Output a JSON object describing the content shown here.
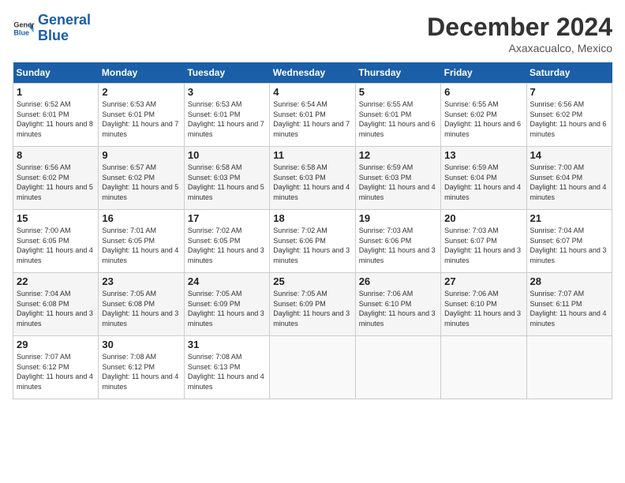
{
  "header": {
    "logo_line1": "General",
    "logo_line2": "Blue",
    "month": "December 2024",
    "location": "Axaxacualco, Mexico"
  },
  "weekdays": [
    "Sunday",
    "Monday",
    "Tuesday",
    "Wednesday",
    "Thursday",
    "Friday",
    "Saturday"
  ],
  "weeks": [
    [
      {
        "day": "1",
        "sunrise": "6:52 AM",
        "sunset": "6:01 PM",
        "daylight": "11 hours and 8 minutes."
      },
      {
        "day": "2",
        "sunrise": "6:53 AM",
        "sunset": "6:01 PM",
        "daylight": "11 hours and 7 minutes."
      },
      {
        "day": "3",
        "sunrise": "6:53 AM",
        "sunset": "6:01 PM",
        "daylight": "11 hours and 7 minutes."
      },
      {
        "day": "4",
        "sunrise": "6:54 AM",
        "sunset": "6:01 PM",
        "daylight": "11 hours and 7 minutes."
      },
      {
        "day": "5",
        "sunrise": "6:55 AM",
        "sunset": "6:01 PM",
        "daylight": "11 hours and 6 minutes."
      },
      {
        "day": "6",
        "sunrise": "6:55 AM",
        "sunset": "6:02 PM",
        "daylight": "11 hours and 6 minutes."
      },
      {
        "day": "7",
        "sunrise": "6:56 AM",
        "sunset": "6:02 PM",
        "daylight": "11 hours and 6 minutes."
      }
    ],
    [
      {
        "day": "8",
        "sunrise": "6:56 AM",
        "sunset": "6:02 PM",
        "daylight": "11 hours and 5 minutes."
      },
      {
        "day": "9",
        "sunrise": "6:57 AM",
        "sunset": "6:02 PM",
        "daylight": "11 hours and 5 minutes."
      },
      {
        "day": "10",
        "sunrise": "6:58 AM",
        "sunset": "6:03 PM",
        "daylight": "11 hours and 5 minutes."
      },
      {
        "day": "11",
        "sunrise": "6:58 AM",
        "sunset": "6:03 PM",
        "daylight": "11 hours and 4 minutes."
      },
      {
        "day": "12",
        "sunrise": "6:59 AM",
        "sunset": "6:03 PM",
        "daylight": "11 hours and 4 minutes."
      },
      {
        "day": "13",
        "sunrise": "6:59 AM",
        "sunset": "6:04 PM",
        "daylight": "11 hours and 4 minutes."
      },
      {
        "day": "14",
        "sunrise": "7:00 AM",
        "sunset": "6:04 PM",
        "daylight": "11 hours and 4 minutes."
      }
    ],
    [
      {
        "day": "15",
        "sunrise": "7:00 AM",
        "sunset": "6:05 PM",
        "daylight": "11 hours and 4 minutes."
      },
      {
        "day": "16",
        "sunrise": "7:01 AM",
        "sunset": "6:05 PM",
        "daylight": "11 hours and 4 minutes."
      },
      {
        "day": "17",
        "sunrise": "7:02 AM",
        "sunset": "6:05 PM",
        "daylight": "11 hours and 3 minutes."
      },
      {
        "day": "18",
        "sunrise": "7:02 AM",
        "sunset": "6:06 PM",
        "daylight": "11 hours and 3 minutes."
      },
      {
        "day": "19",
        "sunrise": "7:03 AM",
        "sunset": "6:06 PM",
        "daylight": "11 hours and 3 minutes."
      },
      {
        "day": "20",
        "sunrise": "7:03 AM",
        "sunset": "6:07 PM",
        "daylight": "11 hours and 3 minutes."
      },
      {
        "day": "21",
        "sunrise": "7:04 AM",
        "sunset": "6:07 PM",
        "daylight": "11 hours and 3 minutes."
      }
    ],
    [
      {
        "day": "22",
        "sunrise": "7:04 AM",
        "sunset": "6:08 PM",
        "daylight": "11 hours and 3 minutes."
      },
      {
        "day": "23",
        "sunrise": "7:05 AM",
        "sunset": "6:08 PM",
        "daylight": "11 hours and 3 minutes."
      },
      {
        "day": "24",
        "sunrise": "7:05 AM",
        "sunset": "6:09 PM",
        "daylight": "11 hours and 3 minutes."
      },
      {
        "day": "25",
        "sunrise": "7:05 AM",
        "sunset": "6:09 PM",
        "daylight": "11 hours and 3 minutes."
      },
      {
        "day": "26",
        "sunrise": "7:06 AM",
        "sunset": "6:10 PM",
        "daylight": "11 hours and 3 minutes."
      },
      {
        "day": "27",
        "sunrise": "7:06 AM",
        "sunset": "6:10 PM",
        "daylight": "11 hours and 3 minutes."
      },
      {
        "day": "28",
        "sunrise": "7:07 AM",
        "sunset": "6:11 PM",
        "daylight": "11 hours and 4 minutes."
      }
    ],
    [
      {
        "day": "29",
        "sunrise": "7:07 AM",
        "sunset": "6:12 PM",
        "daylight": "11 hours and 4 minutes."
      },
      {
        "day": "30",
        "sunrise": "7:08 AM",
        "sunset": "6:12 PM",
        "daylight": "11 hours and 4 minutes."
      },
      {
        "day": "31",
        "sunrise": "7:08 AM",
        "sunset": "6:13 PM",
        "daylight": "11 hours and 4 minutes."
      },
      null,
      null,
      null,
      null
    ]
  ]
}
